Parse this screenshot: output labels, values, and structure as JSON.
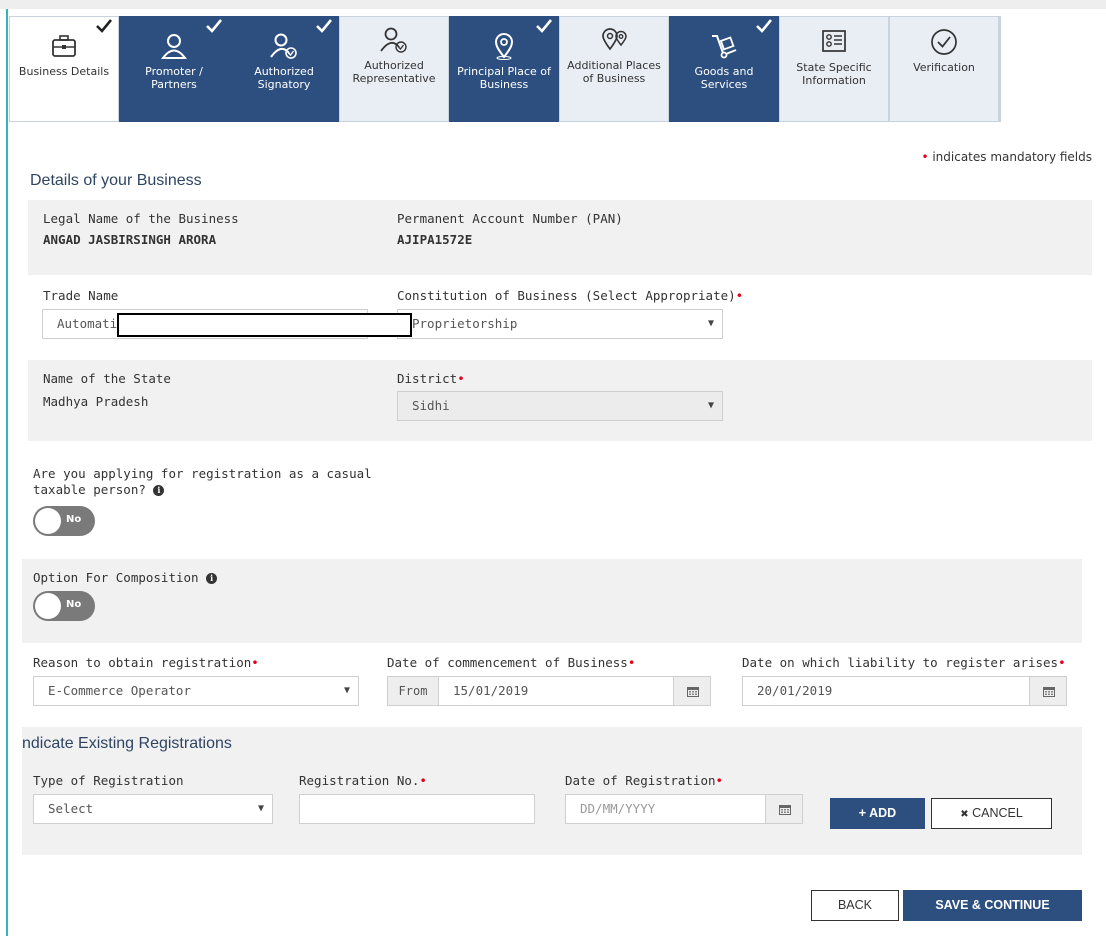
{
  "tabs": [
    {
      "label": "Business Details",
      "icon": "briefcase-icon",
      "state": "active",
      "completed": true
    },
    {
      "label": "Promoter / Partners",
      "icon": "person-icon",
      "state": "done",
      "completed": true
    },
    {
      "label": "Authorized Signatory",
      "icon": "person-check-icon",
      "state": "done",
      "completed": true
    },
    {
      "label": "Authorized Representative",
      "icon": "person-check-icon",
      "state": "pending",
      "completed": false
    },
    {
      "label": "Principal Place of Business",
      "icon": "location-pin-icon",
      "state": "done",
      "completed": true
    },
    {
      "label": "Additional Places of Business",
      "icon": "location-pins-icon",
      "state": "pending",
      "completed": false
    },
    {
      "label": "Goods and Services",
      "icon": "hand-truck-icon",
      "state": "done",
      "completed": true
    },
    {
      "label": "State Specific Information",
      "icon": "id-card-icon",
      "state": "pending",
      "completed": false
    },
    {
      "label": "Verification",
      "icon": "check-circle-icon",
      "state": "pending",
      "completed": false
    }
  ],
  "mandatory_note": "indicates mandatory fields",
  "mandatory_marker": "•",
  "business": {
    "section_title": "Details of your Business",
    "legal_name_label": "Legal Name of the Business",
    "legal_name_value": "ANGAD JASBIRSINGH ARORA",
    "pan_label": "Permanent Account Number (PAN)",
    "pan_value": "AJIPA1572E",
    "trade_name_label": "Trade Name",
    "trade_name_value": "Automati",
    "constitution_label": "Constitution of Business (Select Appropriate)",
    "constitution_value": "Proprietorship",
    "state_label": "Name of the State",
    "state_value": "Madhya Pradesh",
    "district_label": "District",
    "district_value": "Sidhi",
    "casual_label_line1": "Are you applying for registration as a casual",
    "casual_label_line2": "taxable person?",
    "casual_toggle": "No",
    "composition_label": "Option For Composition",
    "composition_toggle": "No",
    "reason_label": "Reason to obtain registration",
    "reason_value": "E-Commerce Operator",
    "commencement_label": "Date of commencement of Business",
    "commencement_prefix": "From",
    "commencement_value": "15/01/2019",
    "liability_label": "Date on which liability to register arises",
    "liability_value": "20/01/2019"
  },
  "existing": {
    "section_title": "ndicate Existing Registrations",
    "type_label": "Type of Registration",
    "type_value": "Select",
    "regno_label": "Registration No.",
    "regno_value": "",
    "date_label": "Date of Registration",
    "date_placeholder": "DD/MM/YYYY",
    "add_button": "ADD",
    "add_glyph": "+",
    "cancel_button": "CANCEL",
    "cancel_glyph": "✖"
  },
  "footer": {
    "back_button": "BACK",
    "save_button": "SAVE & CONTINUE"
  },
  "info_glyph": "i",
  "caret_glyph": "▼",
  "colors": {
    "primary": "#2d4f80",
    "mandatory": "#e4001b",
    "accent_line": "#34b3c7"
  }
}
